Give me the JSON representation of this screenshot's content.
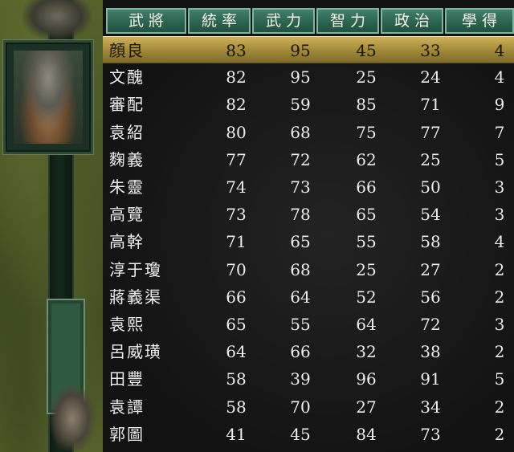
{
  "headers": [
    "武將",
    "統率",
    "武力",
    "智力",
    "政治",
    "學得"
  ],
  "selected_index": 0,
  "rows": [
    {
      "name": "顔良",
      "lead": "83",
      "war": "95",
      "int": "45",
      "pol": "33",
      "learn": "4"
    },
    {
      "name": "文醜",
      "lead": "82",
      "war": "95",
      "int": "25",
      "pol": "24",
      "learn": "4"
    },
    {
      "name": "審配",
      "lead": "82",
      "war": "59",
      "int": "85",
      "pol": "71",
      "learn": "9"
    },
    {
      "name": "袁紹",
      "lead": "80",
      "war": "68",
      "int": "75",
      "pol": "77",
      "learn": "7"
    },
    {
      "name": "麴義",
      "lead": "77",
      "war": "72",
      "int": "62",
      "pol": "25",
      "learn": "5"
    },
    {
      "name": "朱靈",
      "lead": "74",
      "war": "73",
      "int": "66",
      "pol": "50",
      "learn": "3"
    },
    {
      "name": "高覽",
      "lead": "73",
      "war": "78",
      "int": "65",
      "pol": "54",
      "learn": "3"
    },
    {
      "name": "高幹",
      "lead": "71",
      "war": "65",
      "int": "55",
      "pol": "58",
      "learn": "4"
    },
    {
      "name": "淳于瓊",
      "lead": "70",
      "war": "68",
      "int": "25",
      "pol": "27",
      "learn": "2"
    },
    {
      "name": "蔣義渠",
      "lead": "66",
      "war": "64",
      "int": "52",
      "pol": "56",
      "learn": "2"
    },
    {
      "name": "袁熙",
      "lead": "65",
      "war": "55",
      "int": "64",
      "pol": "72",
      "learn": "3"
    },
    {
      "name": "呂威璜",
      "lead": "64",
      "war": "66",
      "int": "32",
      "pol": "38",
      "learn": "2"
    },
    {
      "name": "田豐",
      "lead": "58",
      "war": "39",
      "int": "96",
      "pol": "91",
      "learn": "5"
    },
    {
      "name": "袁譚",
      "lead": "58",
      "war": "70",
      "int": "27",
      "pol": "34",
      "learn": "2"
    },
    {
      "name": "郭圖",
      "lead": "41",
      "war": "45",
      "int": "84",
      "pol": "73",
      "learn": "2"
    }
  ]
}
